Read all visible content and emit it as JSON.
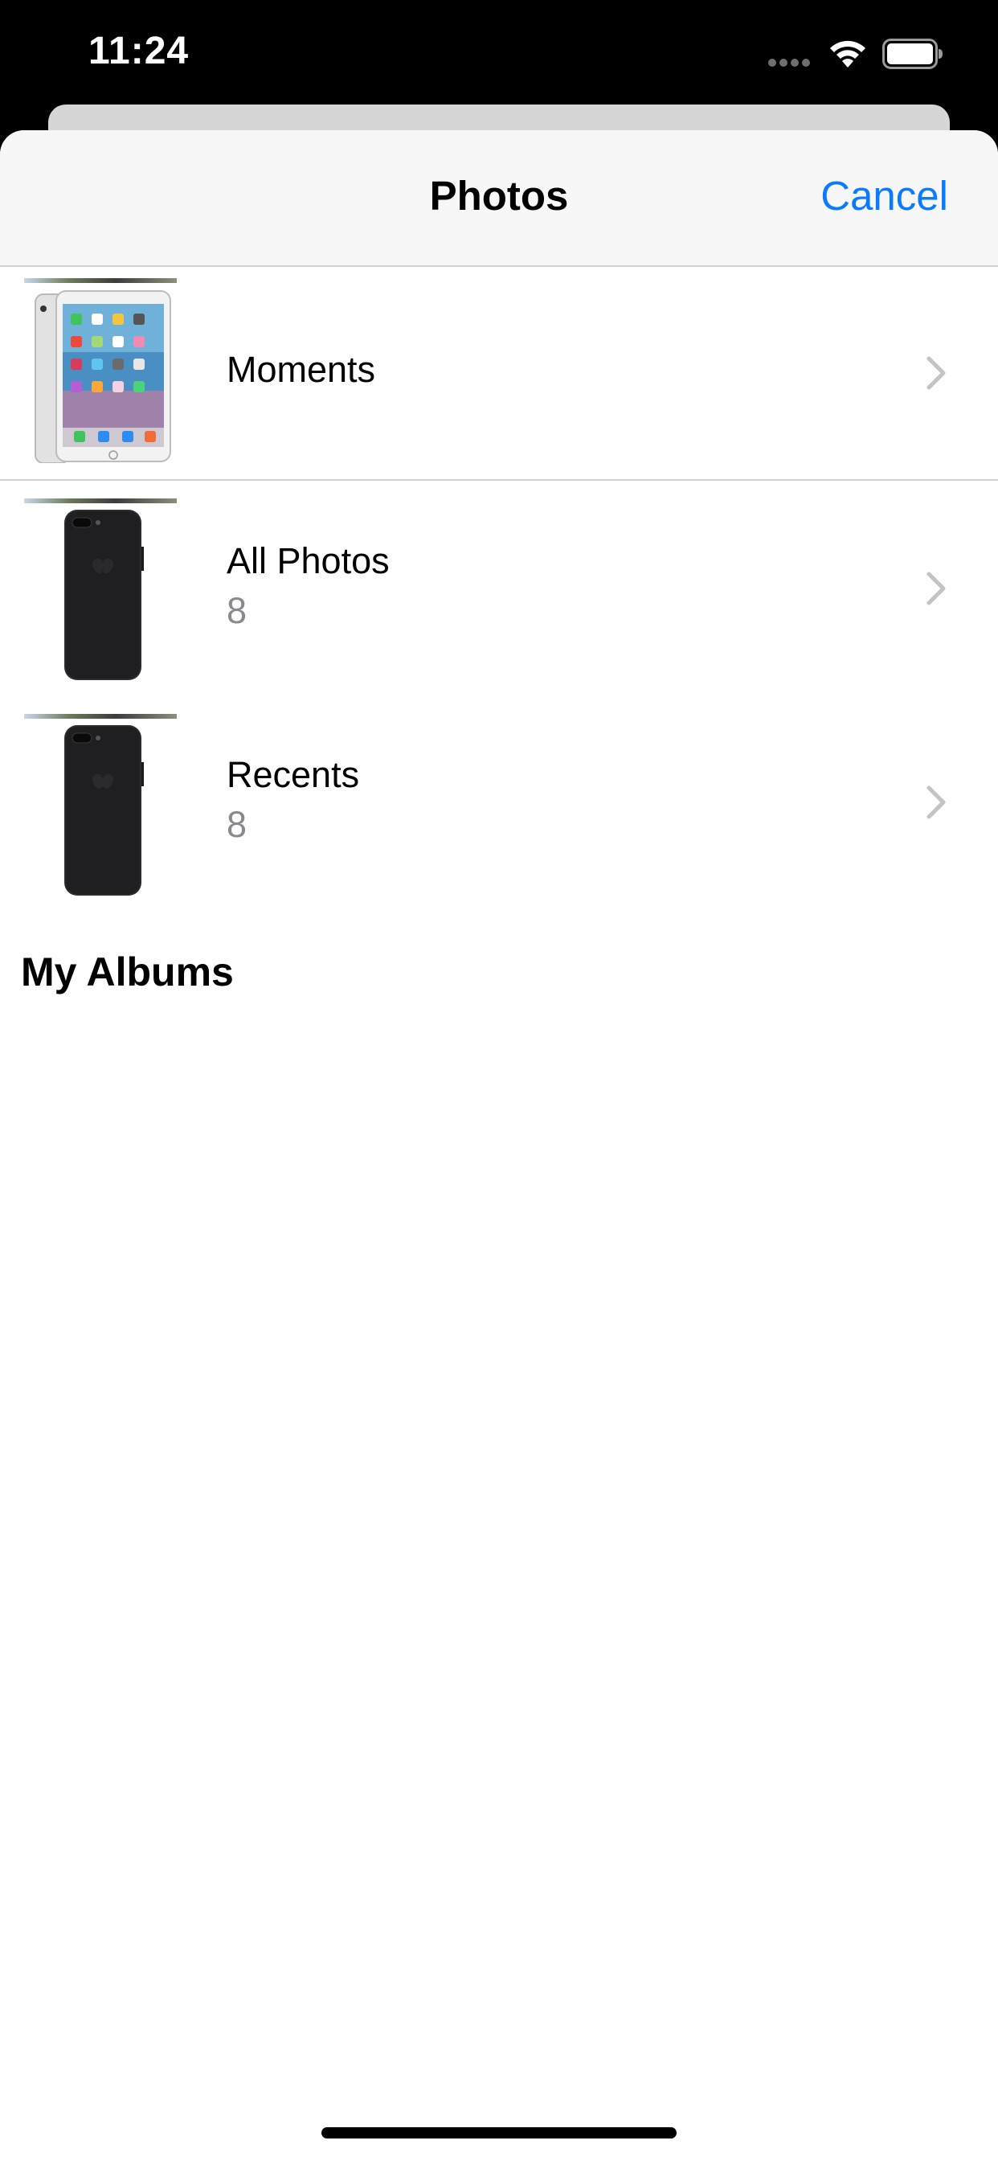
{
  "status_bar": {
    "time": "11:24"
  },
  "nav": {
    "title": "Photos",
    "cancel_label": "Cancel"
  },
  "albums": [
    {
      "title": "Moments",
      "count": "",
      "thumbnail": "ipad-image"
    },
    {
      "title": "All Photos",
      "count": "8",
      "thumbnail": "iphone-image"
    },
    {
      "title": "Recents",
      "count": "8",
      "thumbnail": "iphone-image"
    }
  ],
  "sections": {
    "my_albums": "My Albums"
  },
  "colors": {
    "accent": "#0a7aff",
    "secondary_text": "#8a8a8e",
    "nav_background": "#f7f7f7",
    "separator": "#d0d0d3"
  }
}
